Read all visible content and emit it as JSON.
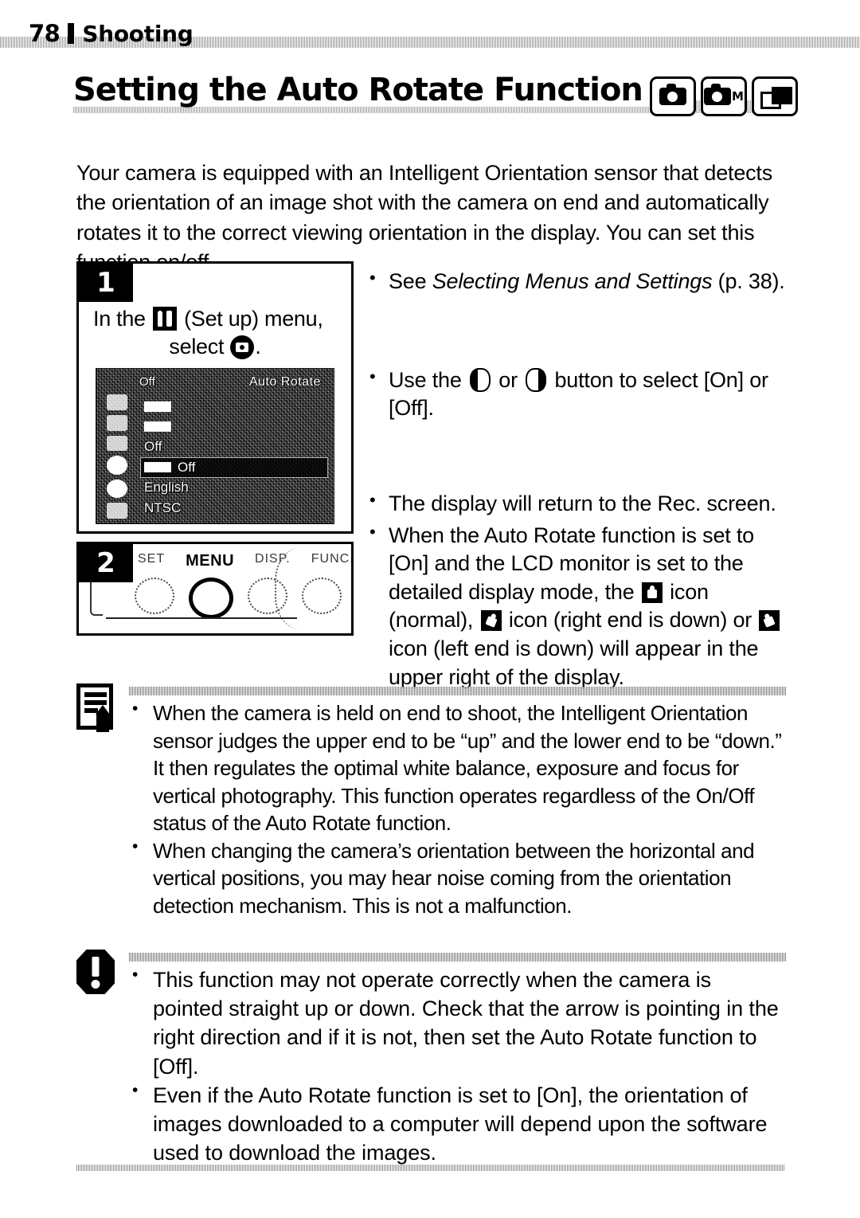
{
  "header": {
    "page_number": "78",
    "section": "Shooting"
  },
  "title": {
    "text": "Setting the Auto Rotate Function",
    "mode_icons": [
      "camera-auto-mode",
      "camera-manual-mode",
      "stitch-assist-mode"
    ],
    "mode_manual_letter": "M"
  },
  "intro": "Your camera is equipped with an Intelligent Orientation sensor that detects the orientation of an image shot with the camera on end and automatically rotates it to the correct viewing orientation in the display. You can set this function on/off.",
  "steps": [
    {
      "number": "1",
      "text_before_icon": "In the ",
      "text_after_icon": " (Set up) menu,",
      "text_line2_before": "select ",
      "text_line2_after": ".",
      "screen": {
        "tab_label": "Off",
        "title": "Auto Rotate",
        "rows": [
          {
            "label": "",
            "value": "",
            "highlight": false
          },
          {
            "label": "",
            "value": "",
            "highlight": false
          },
          {
            "label": "Off",
            "value": "",
            "highlight": false
          },
          {
            "label": "Off",
            "value": "",
            "highlight": true
          },
          {
            "label": "English",
            "value": "",
            "highlight": false
          },
          {
            "label": "NTSC",
            "value": "",
            "highlight": false
          }
        ]
      }
    },
    {
      "number": "2",
      "button_labels": [
        "SET",
        "MENU",
        "DISP.",
        "FUNC."
      ],
      "active_button": "MENU"
    }
  ],
  "right_bullets": [
    {
      "id": "see-selecting-menus",
      "prefix": "See ",
      "italic": "Selecting Menus and Settings",
      "suffix": " (p. 38)."
    },
    {
      "id": "use-button-select",
      "before": "Use the ",
      "middle": " or ",
      "after": " button to select [On] or [Off]."
    },
    {
      "id": "display-return",
      "text": "The display will return to the Rec. screen."
    },
    {
      "id": "auto-rotate-icons",
      "part1": "When the Auto Rotate function is set to [On] and the LCD monitor is set to the detailed display mode, the ",
      "part2": " icon (normal), ",
      "part3": " icon (right end is down) or ",
      "part4": " icon (left end is down) will appear in the upper right of the display."
    }
  ],
  "memo_note": {
    "icon": "memo-pencil-icon",
    "items": [
      "When the camera is held on end to shoot, the Intelligent Orientation sensor judges the upper end to be “up” and the lower end to be “down.” It then regulates the optimal white balance, exposure and focus for vertical photography. This function operates regardless of the On/Off status of the Auto Rotate function.",
      "When changing the camera’s orientation between the horizontal and vertical positions, you may hear noise coming from the orientation detection mechanism. This is not a malfunction."
    ]
  },
  "caution_note": {
    "icon": "caution-exclamation-icon",
    "items": [
      "This function may not operate correctly when the camera is pointed straight up or down. Check that the arrow is pointing in the right direction and if it is not, then set the Auto Rotate function to [Off].",
      "Even if the Auto Rotate function is set to [On], the orientation of images downloaded to a computer will depend upon the software used to download the images."
    ]
  }
}
